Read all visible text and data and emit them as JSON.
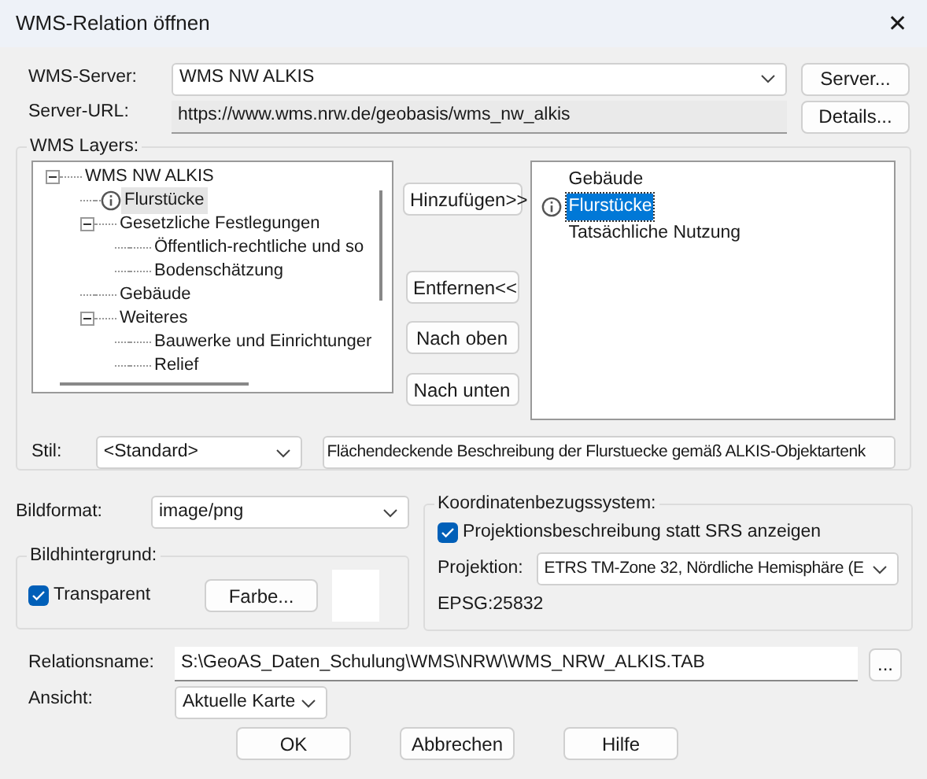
{
  "window": {
    "title": "WMS-Relation öffnen",
    "close": "✕"
  },
  "server": {
    "label": "WMS-Server:",
    "value": "WMS NW ALKIS",
    "button": "Server..."
  },
  "server_url": {
    "label": "Server-URL:",
    "value": "https://www.wms.nrw.de/geobasis/wms_nw_alkis",
    "button": "Details..."
  },
  "wms_layers": {
    "label": "WMS Layers:",
    "tree": [
      {
        "label": "WMS NW ALKIS",
        "expanded": true,
        "selected": false,
        "info": false,
        "children": [
          {
            "label": "Flurstücke",
            "selected": true,
            "info": true
          },
          {
            "label": "Gesetzliche Festlegungen",
            "expanded": true,
            "selected": false,
            "info": false,
            "children": [
              {
                "label": "Öffentlich-rechtliche und so",
                "selected": false,
                "info": false
              },
              {
                "label": "Bodenschätzung",
                "selected": false,
                "info": false
              }
            ]
          },
          {
            "label": "Gebäude",
            "selected": false,
            "info": false
          },
          {
            "label": "Weiteres",
            "expanded": true,
            "selected": false,
            "info": false,
            "children": [
              {
                "label": "Bauwerke und Einrichtunger",
                "selected": false,
                "info": false
              },
              {
                "label": "Relief",
                "selected": false,
                "info": false
              }
            ]
          }
        ]
      }
    ],
    "buttons": [
      "Hinzufügen>>",
      "Entfernen<<",
      "Nach oben",
      "Nach unten"
    ],
    "selected_layers": [
      {
        "label": "Gebäude",
        "selected": false,
        "info": false
      },
      {
        "label": "Flurstücke",
        "selected": true,
        "info": true
      },
      {
        "label": "Tatsächliche Nutzung",
        "selected": false,
        "info": false
      }
    ],
    "style": {
      "label": "Stil:",
      "value": "<Standard>",
      "description": "Flächendeckende Beschreibung der Flurstuecke gemäß ALKIS-Objektartenk"
    }
  },
  "image_format": {
    "label": "Bildformat:",
    "value": "image/png"
  },
  "background": {
    "label": "Bildhintergrund:",
    "transparent_label": "Transparent",
    "checked": true,
    "button": "Farbe...",
    "color": "#ffffff"
  },
  "crs": {
    "label": "Koordinatenbezugssystem:",
    "checkbox_label": "Projektionsbeschreibung statt SRS anzeigen",
    "checked": true,
    "projection_label": "Projektion:",
    "projection": "ETRS TM-Zone 32, Nördliche Hemisphäre (E",
    "epsg": "EPSG:25832"
  },
  "relation": {
    "label": "Relationsname:",
    "value": "S:\\GeoAS_Daten_Schulung\\WMS\\NRW\\WMS_NRW_ALKIS.TAB",
    "browse": "..."
  },
  "view": {
    "label": "Ansicht:",
    "value": "Aktuelle Karte"
  },
  "footer": [
    "OK",
    "Abbrechen",
    "Hilfe"
  ]
}
